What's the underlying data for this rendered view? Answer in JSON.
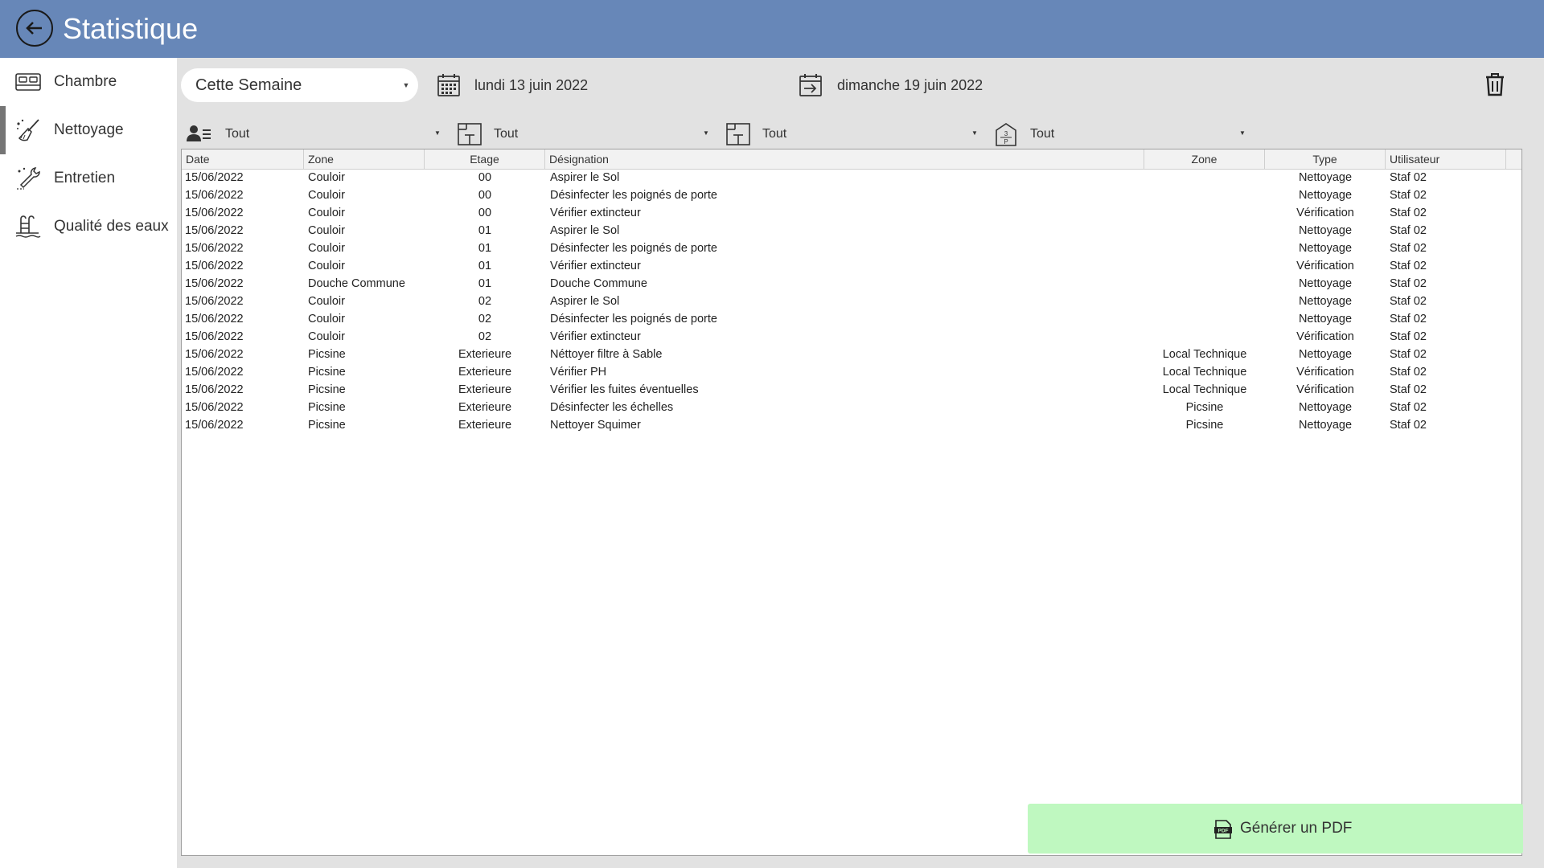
{
  "header": {
    "title": "Statistique"
  },
  "sidebar": {
    "items": [
      {
        "label": "Chambre",
        "icon": "bed-icon",
        "active": false
      },
      {
        "label": "Nettoyage",
        "icon": "broom-icon",
        "active": true
      },
      {
        "label": "Entretien",
        "icon": "wrench-icon",
        "active": false
      },
      {
        "label": "Qualité des eaux",
        "icon": "pool-ladder-icon",
        "active": false
      }
    ]
  },
  "toolbar": {
    "period": "Cette Semaine",
    "start_date": "lundi 13 juin 2022",
    "end_date": "dimanche 19 juin 2022"
  },
  "filters": [
    {
      "icon": "users-icon",
      "value": "Tout"
    },
    {
      "icon": "zone-icon",
      "value": "Tout"
    },
    {
      "icon": "zone-icon",
      "value": "Tout"
    },
    {
      "icon": "floor-icon",
      "value": "Tout"
    }
  ],
  "table": {
    "columns": [
      "Date",
      "Zone",
      "Etage",
      "Désignation",
      "Zone",
      "Type",
      "Utilisateur"
    ],
    "rows": [
      [
        "15/06/2022",
        "Couloir",
        "00",
        "Aspirer le Sol",
        "",
        "Nettoyage",
        "Staf 02"
      ],
      [
        "15/06/2022",
        "Couloir",
        "00",
        "Désinfecter les poignés de porte",
        "",
        "Nettoyage",
        "Staf 02"
      ],
      [
        "15/06/2022",
        "Couloir",
        "00",
        "Vérifier extincteur",
        "",
        "Vérification",
        "Staf 02"
      ],
      [
        "15/06/2022",
        "Couloir",
        "01",
        "Aspirer le Sol",
        "",
        "Nettoyage",
        "Staf 02"
      ],
      [
        "15/06/2022",
        "Couloir",
        "01",
        "Désinfecter les poignés de porte",
        "",
        "Nettoyage",
        "Staf 02"
      ],
      [
        "15/06/2022",
        "Couloir",
        "01",
        "Vérifier extincteur",
        "",
        "Vérification",
        "Staf 02"
      ],
      [
        "15/06/2022",
        "Douche Commune",
        "01",
        "Douche Commune",
        "",
        "Nettoyage",
        "Staf 02"
      ],
      [
        "15/06/2022",
        "Couloir",
        "02",
        "Aspirer le Sol",
        "",
        "Nettoyage",
        "Staf 02"
      ],
      [
        "15/06/2022",
        "Couloir",
        "02",
        "Désinfecter les poignés de porte",
        "",
        "Nettoyage",
        "Staf 02"
      ],
      [
        "15/06/2022",
        "Couloir",
        "02",
        "Vérifier extincteur",
        "",
        "Vérification",
        "Staf 02"
      ],
      [
        "15/06/2022",
        "Picsine",
        "Exterieure",
        "Néttoyer filtre à Sable",
        "Local Technique",
        "Nettoyage",
        "Staf 02"
      ],
      [
        "15/06/2022",
        "Picsine",
        "Exterieure",
        "Vérifier PH",
        "Local Technique",
        "Vérification",
        "Staf 02"
      ],
      [
        "15/06/2022",
        "Picsine",
        "Exterieure",
        "Vérifier les fuites éventuelles",
        "Local Technique",
        "Vérification",
        "Staf 02"
      ],
      [
        "15/06/2022",
        "Picsine",
        "Exterieure",
        "Désinfecter les échelles",
        "Picsine",
        "Nettoyage",
        "Staf 02"
      ],
      [
        "15/06/2022",
        "Picsine",
        "Exterieure",
        "Nettoyer Squimer",
        "Picsine",
        "Nettoyage",
        "Staf 02"
      ]
    ]
  },
  "pdf_button": {
    "label": "Générer un PDF"
  },
  "colors": {
    "header": "#6787b8",
    "pdf_button": "#bff8c0",
    "main_bg": "#e2e2e2"
  }
}
